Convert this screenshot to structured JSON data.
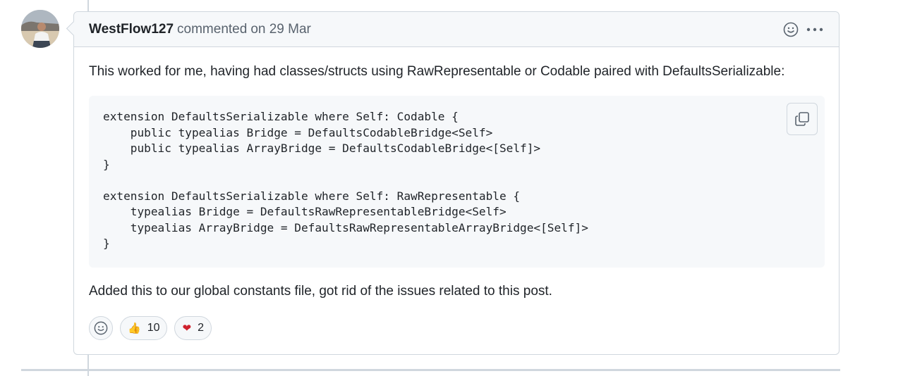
{
  "comment": {
    "author": "WestFlow127",
    "action": "commented",
    "time": "on 29 Mar",
    "body_intro": "This worked for me, having had classes/structs using RawRepresentable or Codable paired with DefaultsSerializable:",
    "code": "extension DefaultsSerializable where Self: Codable {\n    public typealias Bridge = DefaultsCodableBridge<Self>\n    public typealias ArrayBridge = DefaultsCodableBridge<[Self]>\n}\n\nextension DefaultsSerializable where Self: RawRepresentable {\n    typealias Bridge = DefaultsRawRepresentableBridge<Self>\n    typealias ArrayBridge = DefaultsRawRepresentableArrayBridge<[Self]>\n}",
    "body_outro": "Added this to our global constants file, got rid of the issues related to this post.",
    "reactions": [
      {
        "emoji": "👍",
        "icon": "thumbs-up",
        "count": "10"
      },
      {
        "emoji": "❤",
        "icon": "heart",
        "count": "2"
      }
    ]
  },
  "icons": {
    "header_reaction": "smiley-icon",
    "header_menu": "kebab-horizontal-icon",
    "copy": "copy-icon",
    "add_reaction": "smiley-icon"
  },
  "colors": {
    "border": "#d0d7de",
    "header_bg": "#f6f8fa",
    "muted_text": "#59636e",
    "heart": "#cf222e"
  }
}
